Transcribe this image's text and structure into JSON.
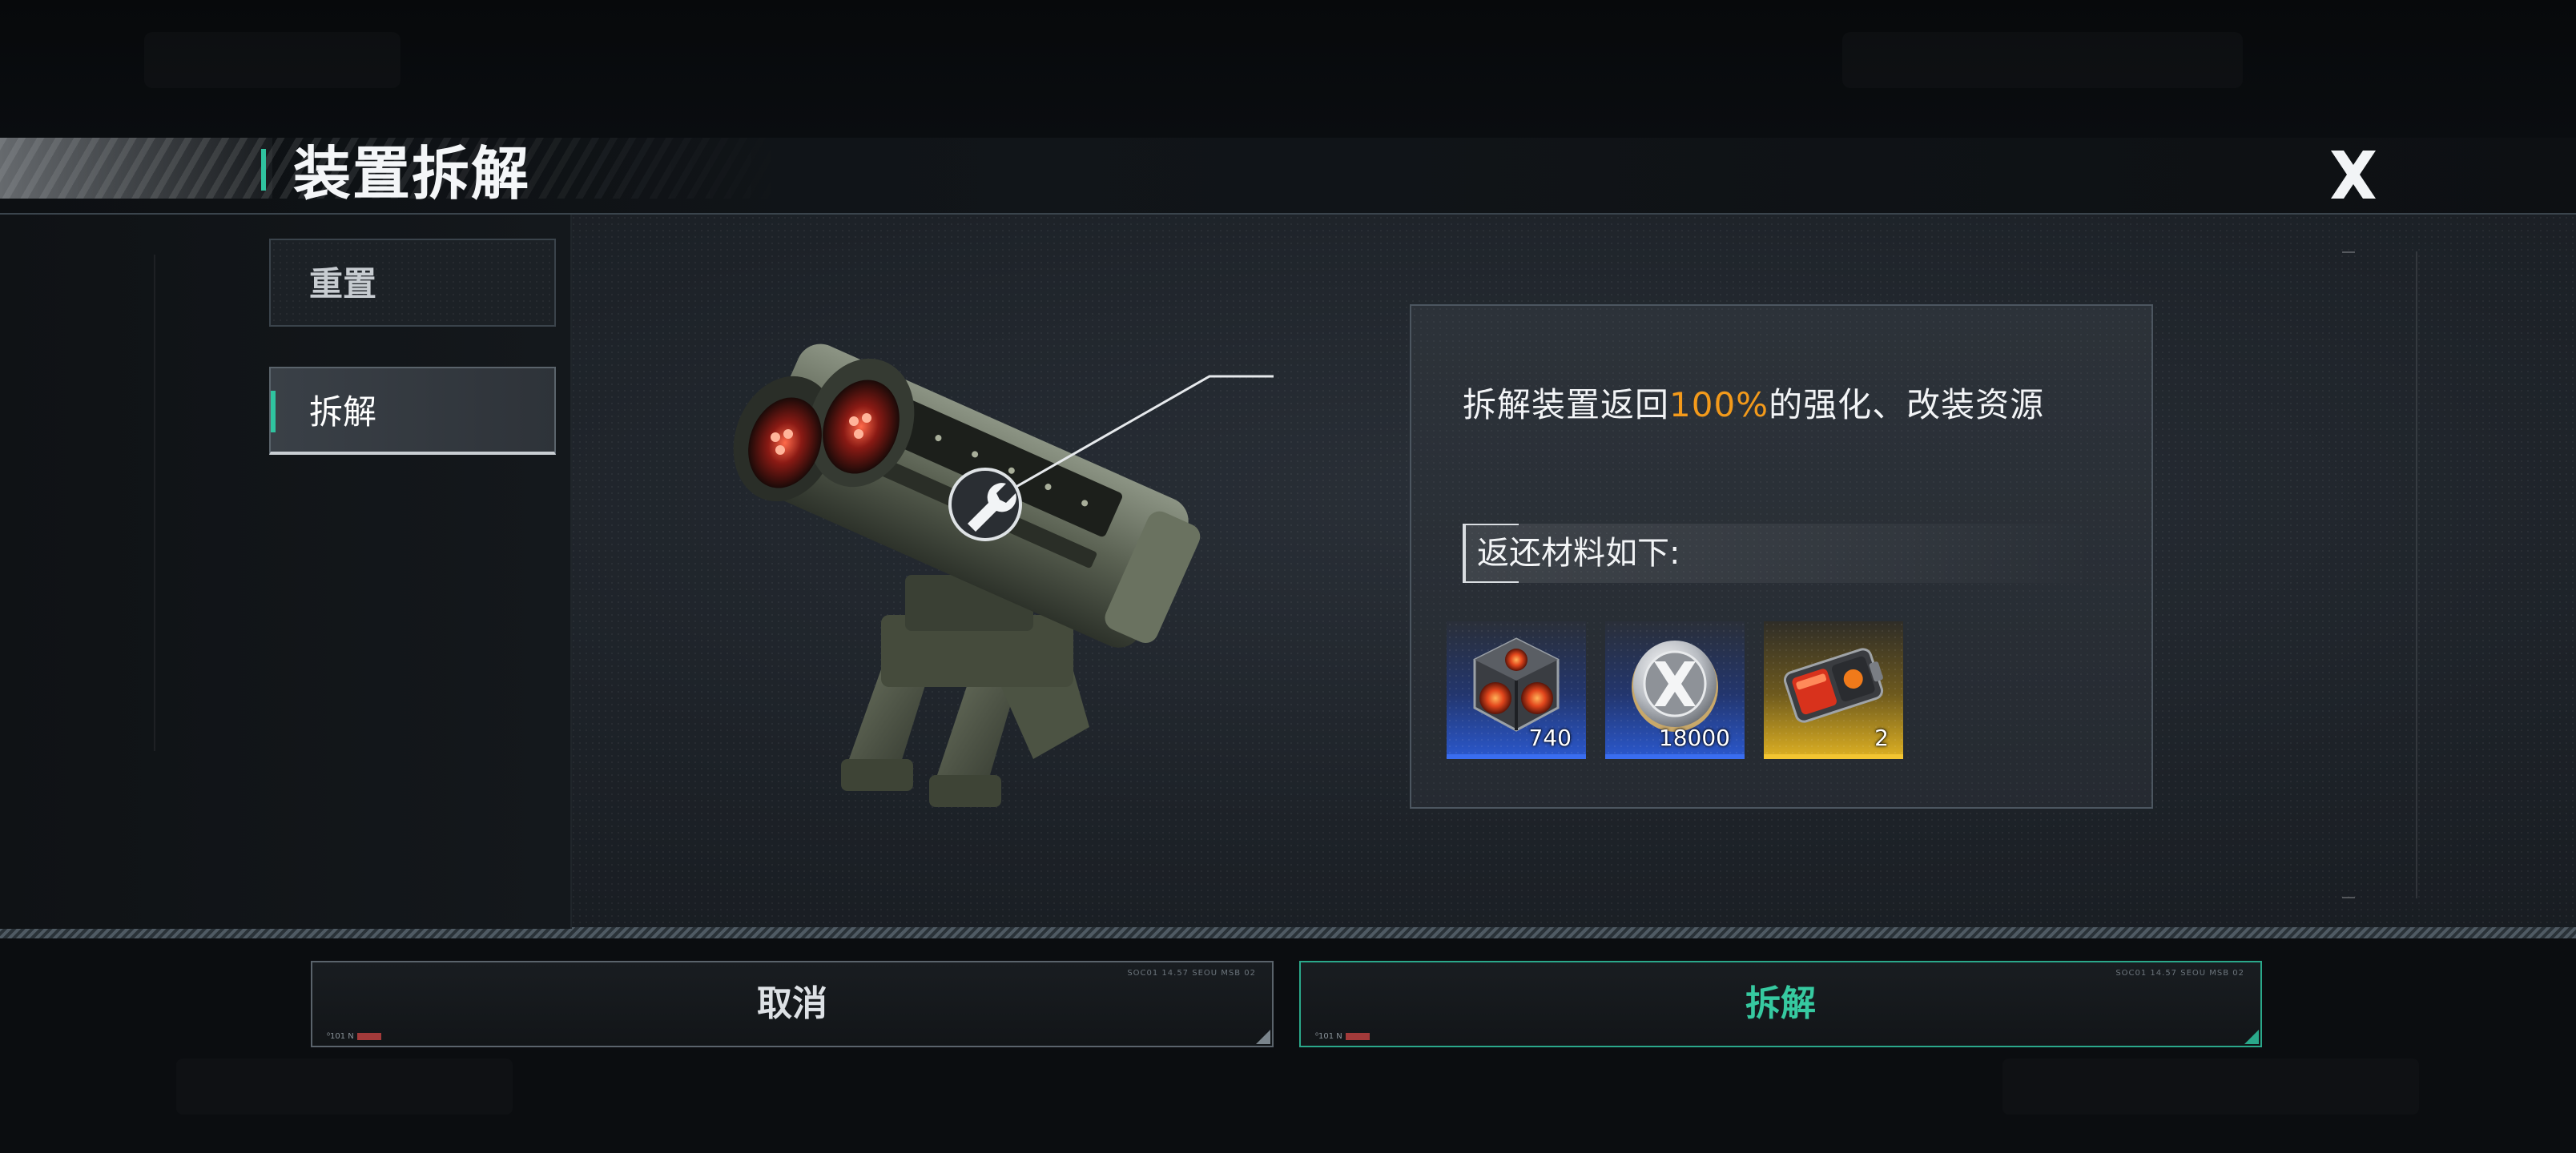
{
  "header": {
    "title": "装置拆解",
    "close_label": "X"
  },
  "sidebar": {
    "tabs": [
      {
        "label": "重置",
        "selected": false
      },
      {
        "label": "拆解",
        "selected": true
      }
    ]
  },
  "info": {
    "desc_prefix": "拆解装置返回",
    "desc_highlight": "100%",
    "desc_suffix": "的强化、改装资源",
    "returns_label": "返还材料如下:",
    "items": [
      {
        "icon": "core-cube-icon",
        "count": "740",
        "rarity": "blue"
      },
      {
        "icon": "x-coin-icon",
        "count": "18000",
        "rarity": "blue"
      },
      {
        "icon": "battery-module-icon",
        "count": "2",
        "rarity": "gold"
      }
    ]
  },
  "footer": {
    "cancel_label": "取消",
    "confirm_label": "拆解",
    "fine_print": "SOC01 14.57      SEOU MSB 02",
    "tag_text": "⁰101 N"
  },
  "colors": {
    "accent": "#2fc39f",
    "highlight": "#f39a1b",
    "rarity_blue": "#3a6df0",
    "rarity_gold": "#f3c531"
  }
}
